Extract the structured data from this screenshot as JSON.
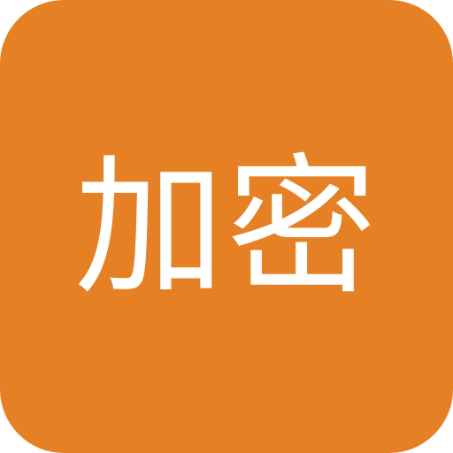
{
  "icon": {
    "label": "加密",
    "background_color": "#E58124",
    "text_color": "#FFFFFF"
  }
}
